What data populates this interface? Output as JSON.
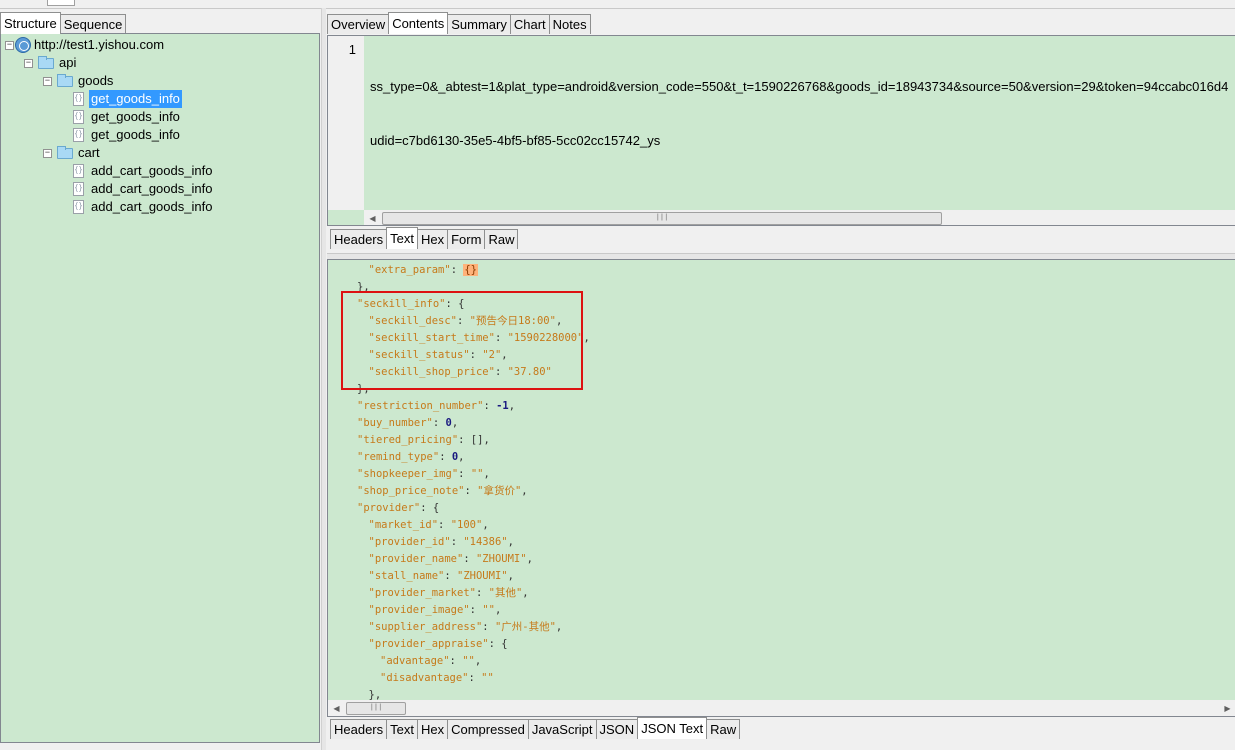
{
  "left_tabs": [
    "Structure",
    "Sequence"
  ],
  "tree": [
    {
      "label": "http://test1.yishou.com",
      "icon": "globe-icon",
      "depth": 0,
      "expander": "⊟"
    },
    {
      "label": "api",
      "icon": "folder-icon",
      "depth": 1,
      "expander": "⊟"
    },
    {
      "label": "goods",
      "icon": "folder-icon",
      "depth": 2,
      "expander": "⊟"
    },
    {
      "label": "get_goods_info",
      "icon": "json-file-icon",
      "depth": 3,
      "selected": true
    },
    {
      "label": "get_goods_info",
      "icon": "json-file-icon",
      "depth": 3
    },
    {
      "label": "get_goods_info",
      "icon": "json-file-icon",
      "depth": 3
    },
    {
      "label": "cart",
      "icon": "folder-icon",
      "depth": 2,
      "expander": "⊟"
    },
    {
      "label": "add_cart_goods_info",
      "icon": "json-file-icon",
      "depth": 3
    },
    {
      "label": "add_cart_goods_info",
      "icon": "json-file-icon",
      "depth": 3
    },
    {
      "label": "add_cart_goods_info",
      "icon": "json-file-icon",
      "depth": 3
    }
  ],
  "top_tabs": [
    "Overview",
    "Contents",
    "Summary",
    "Chart",
    "Notes"
  ],
  "top_active": "Contents",
  "request": {
    "line_number": "1",
    "lines": [
      "ss_type=0&_abtest=1&plat_type=android&version_code=550&t_t=1590226768&goods_id=18943734&source=50&version=29&token=94ccabc016d4",
      "udid=c7bd6130-35e5-4bf5-bf85-5cc02cc15742_ys"
    ]
  },
  "request_tabs": [
    "Headers",
    "Text",
    "Hex",
    "Form",
    "Raw"
  ],
  "request_active": "Text",
  "response_lines": [
    {
      "i": 3,
      "t": [
        [
          "k",
          "\"extra_param\""
        ],
        [
          "p",
          ": "
        ],
        [
          "obj",
          "{}"
        ]
      ]
    },
    {
      "i": 2,
      "t": [
        [
          "p",
          "},"
        ]
      ]
    },
    {
      "i": 2,
      "t": [
        [
          "k",
          "\"seckill_info\""
        ],
        [
          "p",
          ": {"
        ]
      ]
    },
    {
      "i": 3,
      "t": [
        [
          "k",
          "\"seckill_desc\""
        ],
        [
          "p",
          ": "
        ],
        [
          "s",
          "\"预告今日18:00\""
        ],
        [
          "p",
          ","
        ]
      ]
    },
    {
      "i": 3,
      "t": [
        [
          "k",
          "\"seckill_start_time\""
        ],
        [
          "p",
          ": "
        ],
        [
          "s",
          "\"1590228000\""
        ],
        [
          "p",
          ","
        ]
      ]
    },
    {
      "i": 3,
      "t": [
        [
          "k",
          "\"seckill_status\""
        ],
        [
          "p",
          ": "
        ],
        [
          "s",
          "\"2\""
        ],
        [
          "p",
          ","
        ]
      ]
    },
    {
      "i": 3,
      "t": [
        [
          "k",
          "\"seckill_shop_price\""
        ],
        [
          "p",
          ": "
        ],
        [
          "s",
          "\"37.80\""
        ]
      ]
    },
    {
      "i": 2,
      "t": [
        [
          "p",
          "},"
        ]
      ]
    },
    {
      "i": 2,
      "t": [
        [
          "k",
          "\"restriction_number\""
        ],
        [
          "p",
          ": "
        ],
        [
          "n",
          "-1"
        ],
        [
          "p",
          ","
        ]
      ]
    },
    {
      "i": 2,
      "t": [
        [
          "k",
          "\"buy_number\""
        ],
        [
          "p",
          ": "
        ],
        [
          "n",
          "0"
        ],
        [
          "p",
          ","
        ]
      ]
    },
    {
      "i": 2,
      "t": [
        [
          "k",
          "\"tiered_pricing\""
        ],
        [
          "p",
          ": [],"
        ]
      ]
    },
    {
      "i": 2,
      "t": [
        [
          "k",
          "\"remind_type\""
        ],
        [
          "p",
          ": "
        ],
        [
          "n",
          "0"
        ],
        [
          "p",
          ","
        ]
      ]
    },
    {
      "i": 2,
      "t": [
        [
          "k",
          "\"shopkeeper_img\""
        ],
        [
          "p",
          ": "
        ],
        [
          "s",
          "\"\""
        ],
        [
          "p",
          ","
        ]
      ]
    },
    {
      "i": 2,
      "t": [
        [
          "k",
          "\"shop_price_note\""
        ],
        [
          "p",
          ": "
        ],
        [
          "s",
          "\"拿货价\""
        ],
        [
          "p",
          ","
        ]
      ]
    },
    {
      "i": 2,
      "t": [
        [
          "k",
          "\"provider\""
        ],
        [
          "p",
          ": {"
        ]
      ]
    },
    {
      "i": 3,
      "t": [
        [
          "k",
          "\"market_id\""
        ],
        [
          "p",
          ": "
        ],
        [
          "s",
          "\"100\""
        ],
        [
          "p",
          ","
        ]
      ]
    },
    {
      "i": 3,
      "t": [
        [
          "k",
          "\"provider_id\""
        ],
        [
          "p",
          ": "
        ],
        [
          "s",
          "\"14386\""
        ],
        [
          "p",
          ","
        ]
      ]
    },
    {
      "i": 3,
      "t": [
        [
          "k",
          "\"provider_name\""
        ],
        [
          "p",
          ": "
        ],
        [
          "s",
          "\"ZHOUMI\""
        ],
        [
          "p",
          ","
        ]
      ]
    },
    {
      "i": 3,
      "t": [
        [
          "k",
          "\"stall_name\""
        ],
        [
          "p",
          ": "
        ],
        [
          "s",
          "\"ZHOUMI\""
        ],
        [
          "p",
          ","
        ]
      ]
    },
    {
      "i": 3,
      "t": [
        [
          "k",
          "\"provider_market\""
        ],
        [
          "p",
          ": "
        ],
        [
          "s",
          "\"其他\""
        ],
        [
          "p",
          ","
        ]
      ]
    },
    {
      "i": 3,
      "t": [
        [
          "k",
          "\"provider_image\""
        ],
        [
          "p",
          ": "
        ],
        [
          "s",
          "\"\""
        ],
        [
          "p",
          ","
        ]
      ]
    },
    {
      "i": 3,
      "t": [
        [
          "k",
          "\"supplier_address\""
        ],
        [
          "p",
          ": "
        ],
        [
          "s",
          "\"广州-其他\""
        ],
        [
          "p",
          ","
        ]
      ]
    },
    {
      "i": 3,
      "t": [
        [
          "k",
          "\"provider_appraise\""
        ],
        [
          "p",
          ": {"
        ]
      ]
    },
    {
      "i": 4,
      "t": [
        [
          "k",
          "\"advantage\""
        ],
        [
          "p",
          ": "
        ],
        [
          "s",
          "\"\""
        ],
        [
          "p",
          ","
        ]
      ]
    },
    {
      "i": 4,
      "t": [
        [
          "k",
          "\"disadvantage\""
        ],
        [
          "p",
          ": "
        ],
        [
          "s",
          "\"\""
        ]
      ]
    },
    {
      "i": 3,
      "t": [
        [
          "p",
          "},"
        ]
      ]
    }
  ],
  "response_tabs": [
    "Headers",
    "Text",
    "Hex",
    "Compressed",
    "JavaScript",
    "JSON",
    "JSON Text",
    "Raw"
  ],
  "response_active": "JSON Text",
  "colors": {
    "panel_bg": "#cce8cf",
    "key": "#c67a1a",
    "highlight": "#dd1111",
    "selection": "#3399ff"
  }
}
